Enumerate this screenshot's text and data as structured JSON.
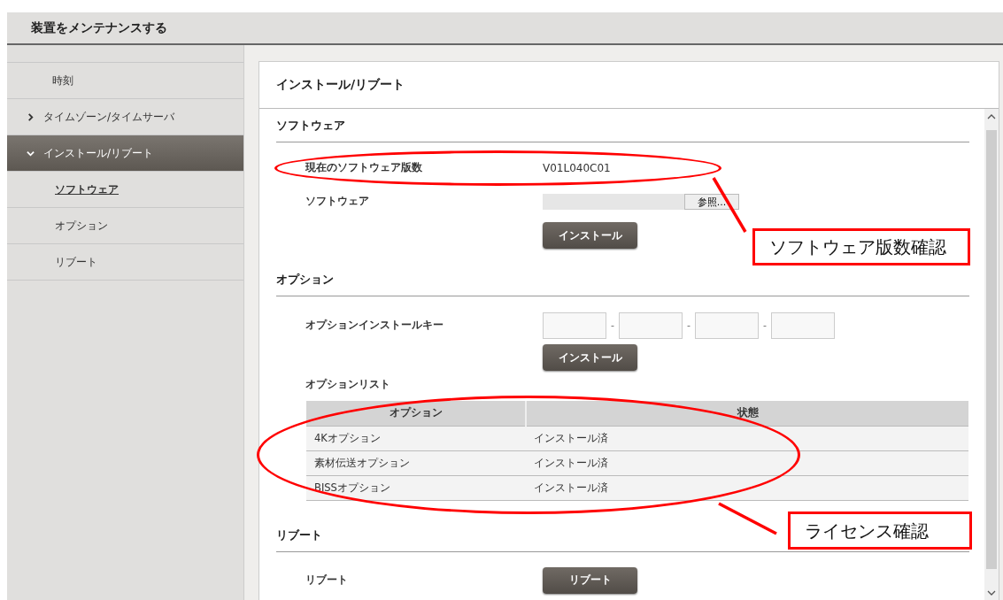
{
  "header": {
    "title": "装置をメンテナンスする"
  },
  "sidebar": {
    "items": [
      {
        "label": "時刻",
        "selected": false
      },
      {
        "label": "タイムゾーン/タイムサーバ",
        "selected": false,
        "expanded": false
      },
      {
        "label": "インストール/リブート",
        "selected": true,
        "expanded": true,
        "children": [
          {
            "label": "ソフトウェア",
            "selected": true
          },
          {
            "label": "オプション",
            "selected": false
          },
          {
            "label": "リブート",
            "selected": false
          }
        ]
      }
    ]
  },
  "panel": {
    "title": "インストール/リブート",
    "software": {
      "heading": "ソフトウェア",
      "version_label": "現在のソフトウェア版数",
      "version": "V01L040C01",
      "file_label": "ソフトウェア",
      "browse_button": "参照...",
      "install_button": "インストール"
    },
    "option": {
      "heading": "オプション",
      "key_label": "オプションインストールキー",
      "key_separators": [
        "-",
        "-",
        "-"
      ],
      "install_button": "インストール",
      "list_label": "オプションリスト",
      "table": {
        "columns": [
          "オプション",
          "状態"
        ],
        "rows": [
          [
            "4Kオプション",
            "インストール済"
          ],
          [
            "素材伝送オプション",
            "インストール済"
          ],
          [
            "BISSオプション",
            "インストール済"
          ]
        ]
      }
    },
    "reboot": {
      "heading": "リブート",
      "label": "リブート",
      "button": "リブート"
    }
  },
  "annotations": [
    {
      "label": "ソフトウェア版数確認"
    },
    {
      "label": "ライセンス確認"
    }
  ]
}
